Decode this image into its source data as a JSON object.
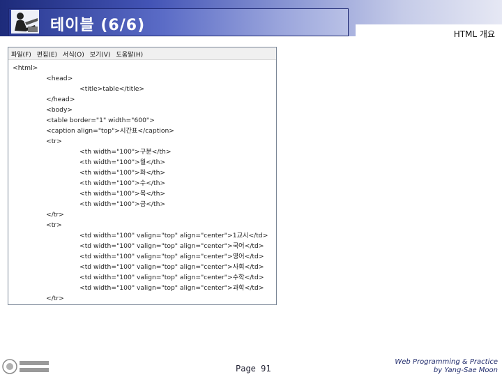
{
  "header": {
    "title": "테이블 (6/6)",
    "section": "HTML 개요"
  },
  "editor": {
    "menu": [
      "파일(F)",
      "편집(E)",
      "서식(O)",
      "보기(V)",
      "도움말(H)"
    ],
    "lines": [
      {
        "indent": 0,
        "text": "<html>"
      },
      {
        "indent": 1,
        "text": "<head>"
      },
      {
        "indent": 2,
        "text": "<title>table</title>"
      },
      {
        "indent": 1,
        "text": "</head>"
      },
      {
        "indent": 1,
        "text": "<body>"
      },
      {
        "indent": 1,
        "text": "<table border=\"1\" width=\"600\">"
      },
      {
        "indent": 1,
        "text": "<caption align=\"top\">시간표</caption>"
      },
      {
        "indent": 1,
        "text": "<tr>"
      },
      {
        "indent": 2,
        "text": "<th width=\"100\">구분</th>"
      },
      {
        "indent": 2,
        "text": "<th width=\"100\">월</th>"
      },
      {
        "indent": 2,
        "text": "<th width=\"100\">화</th>"
      },
      {
        "indent": 2,
        "text": "<th width=\"100\">수</th>"
      },
      {
        "indent": 2,
        "text": "<th width=\"100\">목</th>"
      },
      {
        "indent": 2,
        "text": "<th width=\"100\">금</th>"
      },
      {
        "indent": 1,
        "text": "</tr>"
      },
      {
        "indent": 1,
        "text": "<tr>"
      },
      {
        "indent": 2,
        "text": "<td width=\"100\" valign=\"top\" align=\"center\">1교시</td>"
      },
      {
        "indent": 2,
        "text": "<td width=\"100\" valign=\"top\" align=\"center\">국어</td>"
      },
      {
        "indent": 2,
        "text": "<td width=\"100\" valign=\"top\" align=\"center\">영어</td>"
      },
      {
        "indent": 2,
        "text": "<td width=\"100\" valign=\"top\" align=\"center\">사회</td>"
      },
      {
        "indent": 2,
        "text": "<td width=\"100\" valign=\"top\" align=\"center\">수학</td>"
      },
      {
        "indent": 2,
        "text": "<td width=\"100\" valign=\"top\" align=\"center\">과학</td>"
      },
      {
        "indent": 1,
        "text": "</tr>"
      }
    ]
  },
  "footer": {
    "page": "Page 91",
    "credit_line1": "Web Programming & Practice",
    "credit_line2": "by Yang-Sae Moon"
  },
  "colors": {
    "banner_dark": "#1d2b7a",
    "banner_light": "#c5cbe8",
    "credit_text": "#1f2a6b"
  }
}
